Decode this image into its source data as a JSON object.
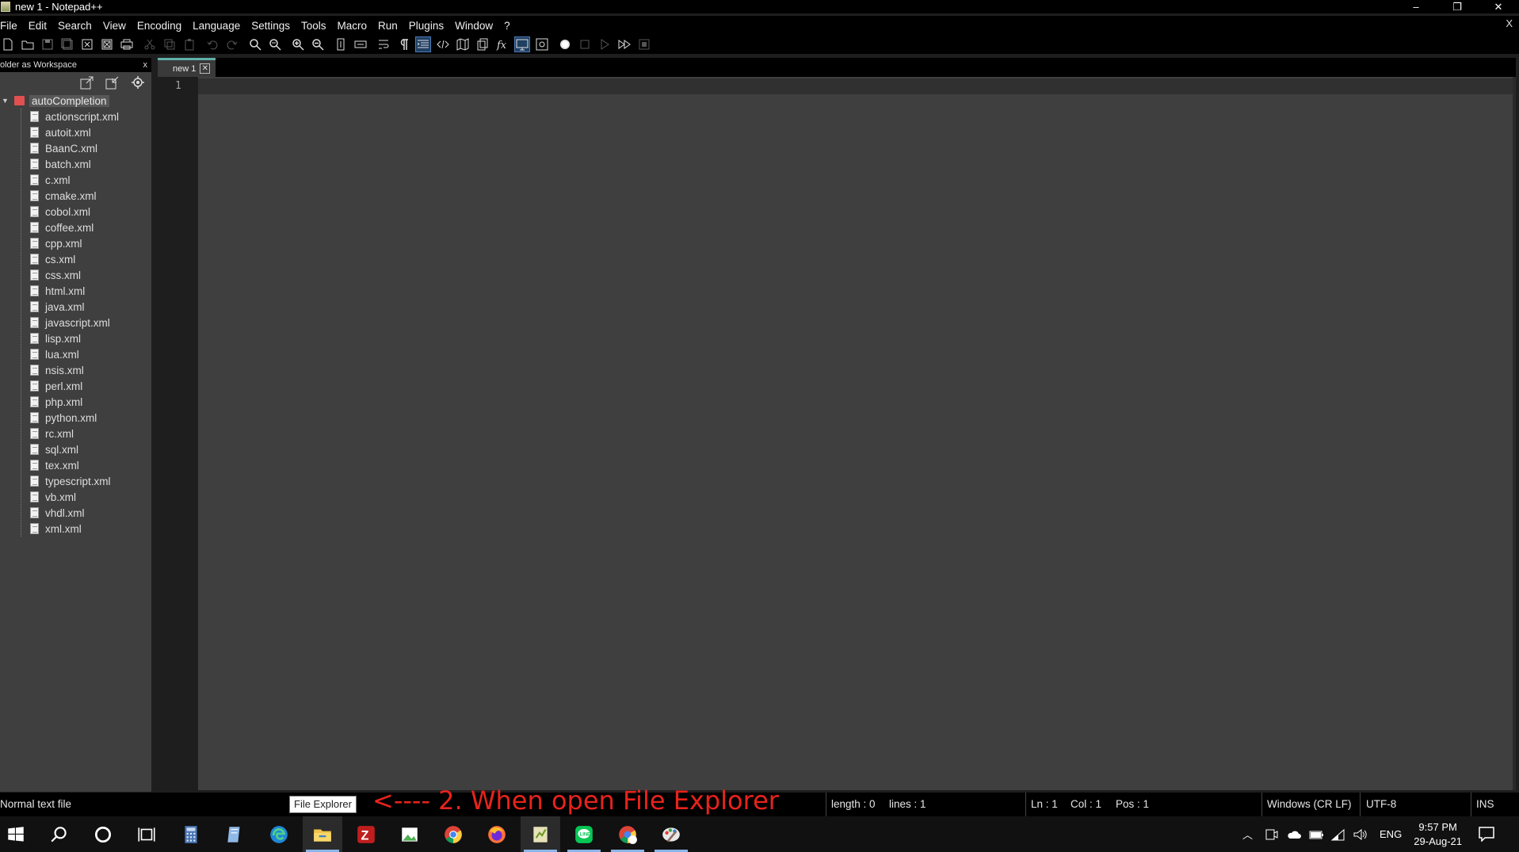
{
  "window": {
    "title": "new 1 - Notepad++",
    "controls": [
      "–",
      "❐",
      "✕"
    ]
  },
  "menu": [
    "File",
    "Edit",
    "Search",
    "View",
    "Encoding",
    "Language",
    "Settings",
    "Tools",
    "Macro",
    "Run",
    "Plugins",
    "Window",
    "?"
  ],
  "doc_close": "X",
  "panel": {
    "title": "older as Workspace",
    "close": "x",
    "root": "autoCompletion",
    "files": [
      "actionscript.xml",
      "autoit.xml",
      "BaanC.xml",
      "batch.xml",
      "c.xml",
      "cmake.xml",
      "cobol.xml",
      "coffee.xml",
      "cpp.xml",
      "cs.xml",
      "css.xml",
      "html.xml",
      "java.xml",
      "javascript.xml",
      "lisp.xml",
      "lua.xml",
      "nsis.xml",
      "perl.xml",
      "php.xml",
      "python.xml",
      "rc.xml",
      "sql.xml",
      "tex.xml",
      "typescript.xml",
      "vb.xml",
      "vhdl.xml",
      "xml.xml"
    ]
  },
  "tab": {
    "label": "new 1",
    "close": "✕"
  },
  "editor": {
    "line_number": "1"
  },
  "status": {
    "file_type": "Normal text file",
    "length": "length : 0",
    "lines": "lines : 1",
    "ln": "Ln : 1",
    "col": "Col : 1",
    "pos": "Pos : 1",
    "eol": "Windows (CR LF)",
    "encoding": "UTF-8",
    "mode": "INS"
  },
  "tooltip": "File Explorer",
  "annotation": "<---- 2. When open File Explorer",
  "taskbar": {
    "tray_lang": "ENG",
    "time": "9:57 PM",
    "date": "29-Aug-21"
  }
}
